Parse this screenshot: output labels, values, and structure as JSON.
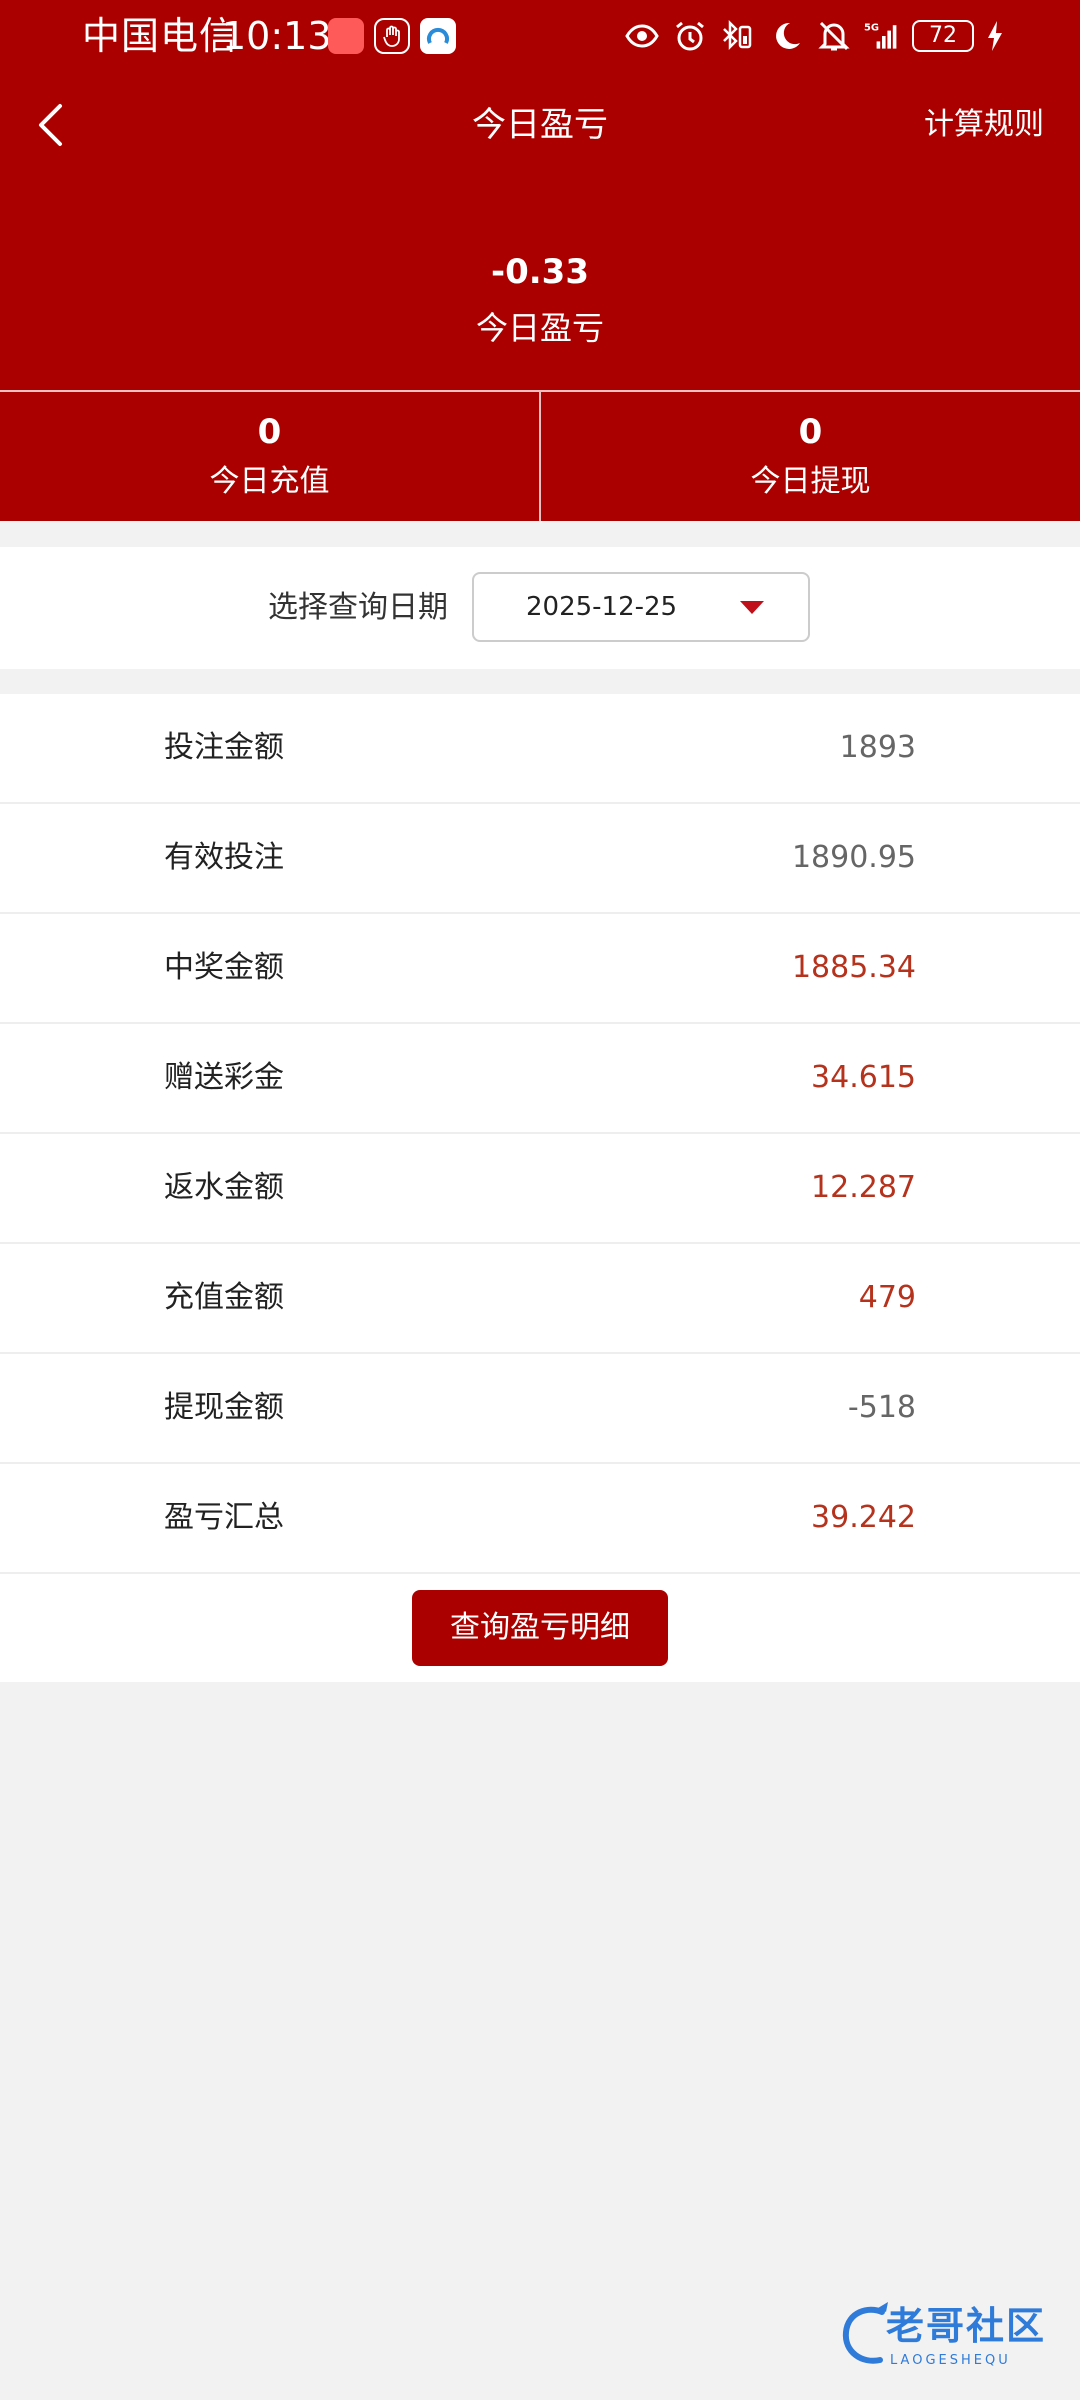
{
  "status_bar": {
    "carrier": "中国电信",
    "time": "10:13",
    "battery": "72",
    "network": "5G"
  },
  "nav": {
    "title": "今日盈亏",
    "rules_label": "计算规则"
  },
  "summary": {
    "value": "-0.33",
    "label": "今日盈亏"
  },
  "stats": [
    {
      "value": "0",
      "label": "今日充值"
    },
    {
      "value": "0",
      "label": "今日提现"
    }
  ],
  "date_query": {
    "label": "选择查询日期",
    "value": "2025-12-25"
  },
  "rows": [
    {
      "label": "投注金额",
      "value": "1893"
    },
    {
      "label": "有效投注",
      "value": "1890.95"
    },
    {
      "label": "中奖金额",
      "value": "1885.34"
    },
    {
      "label": "赠送彩金",
      "value": "34.615"
    },
    {
      "label": "返水金额",
      "value": "12.287"
    },
    {
      "label": "充值金额",
      "value": "479"
    },
    {
      "label": "提现金额",
      "value": "-518"
    },
    {
      "label": "盈亏汇总",
      "value": "39.242"
    }
  ],
  "query_button": "查询盈亏明细",
  "watermark": {
    "text": "老哥社区",
    "sub": "LAOGESHEQU"
  },
  "colors": {
    "header_red": "#ab0000",
    "value_red": "#b5321d",
    "value_gray": "#666666"
  }
}
